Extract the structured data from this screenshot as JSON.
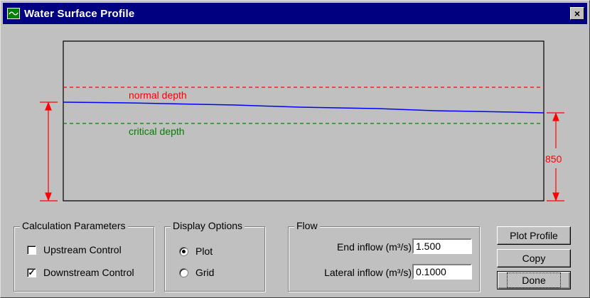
{
  "window": {
    "title": "Water Surface Profile",
    "close_label": "×",
    "icon": "chart-wave-icon"
  },
  "plot": {
    "normal_depth_label": "normal depth",
    "critical_depth_label": "critical depth",
    "dimension_label": "850",
    "colors": {
      "water_surface": "#0000ff",
      "normal_depth": "#ff0000",
      "critical_depth": "#008000",
      "dimension": "#ff0000"
    }
  },
  "calc_params": {
    "title": "Calculation Parameters",
    "upstream": {
      "label": "Upstream Control",
      "checked": false,
      "mark": ""
    },
    "downstream": {
      "label": "Downstream Control",
      "checked": true,
      "mark": "✓"
    }
  },
  "display_options": {
    "title": "Display Options",
    "plot": {
      "label": "Plot",
      "selected": true
    },
    "grid": {
      "label": "Grid",
      "selected": false
    }
  },
  "flow": {
    "title": "Flow",
    "end_inflow_label": "End inflow (m³/s)",
    "end_inflow_value": "1.500",
    "lateral_inflow_label": "Lateral inflow (m³/s)",
    "lateral_inflow_value": "0.1000"
  },
  "buttons": {
    "plot_profile": "Plot Profile",
    "copy": "Copy",
    "done": "Done"
  }
}
